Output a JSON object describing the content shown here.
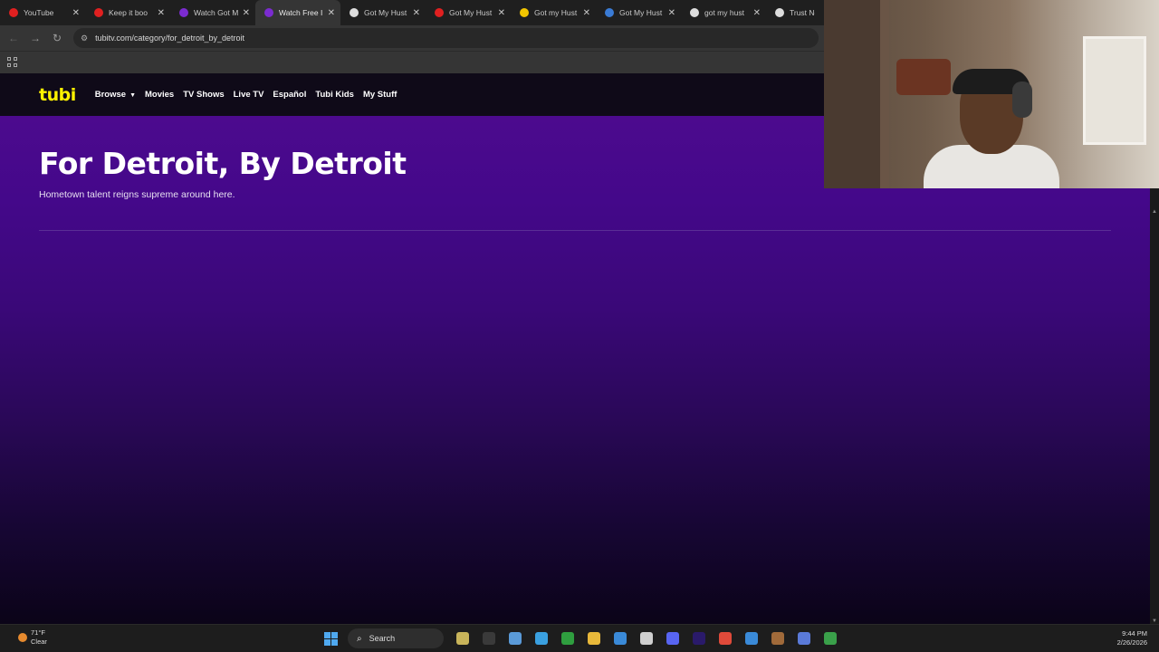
{
  "browser": {
    "tabs": [
      {
        "title": "YouTube",
        "color": "#e02020"
      },
      {
        "title": "Keep it boo",
        "color": "#e02020"
      },
      {
        "title": "Watch Got M",
        "color": "#7b2bd0"
      },
      {
        "title": "Watch Free I",
        "color": "#7b2bd0",
        "active": true
      },
      {
        "title": "Got My Hust",
        "color": "#dddddd"
      },
      {
        "title": "Got My Hust",
        "color": "#e02020"
      },
      {
        "title": "Got my Hust",
        "color": "#f2c500"
      },
      {
        "title": "Got My Hust",
        "color": "#3a7bd5"
      },
      {
        "title": "got my hust",
        "color": "#dddddd"
      },
      {
        "title": "Trust Nob",
        "color": "#dddddd"
      }
    ],
    "url": "tubitv.com/category/for_detroit_by_detroit"
  },
  "tubi": {
    "logo": "tubi",
    "nav": [
      "Browse",
      "Movies",
      "TV Shows",
      "Live TV",
      "Español",
      "Tubi Kids",
      "My Stuff"
    ],
    "headline": "For Detroit, By Detroit",
    "subtitle": "Hometown talent reigns supreme around here."
  },
  "taskbar": {
    "weather_temp": "71°F",
    "weather_desc": "Clear",
    "search_label": "Search",
    "time": "9:44 PM",
    "date": "2/26/2026",
    "app_colors": [
      "#c8b45a",
      "#3a3a3a",
      "#5a9ad8",
      "#3aa0e0",
      "#2f9e3f",
      "#e8b83a",
      "#3a8ad8",
      "#cfcfcf",
      "#5865f2",
      "#2a1a6a",
      "#e04a3a",
      "#3a8ad8",
      "#a06a3a",
      "#5a7ad8",
      "#3aa04a"
    ]
  }
}
